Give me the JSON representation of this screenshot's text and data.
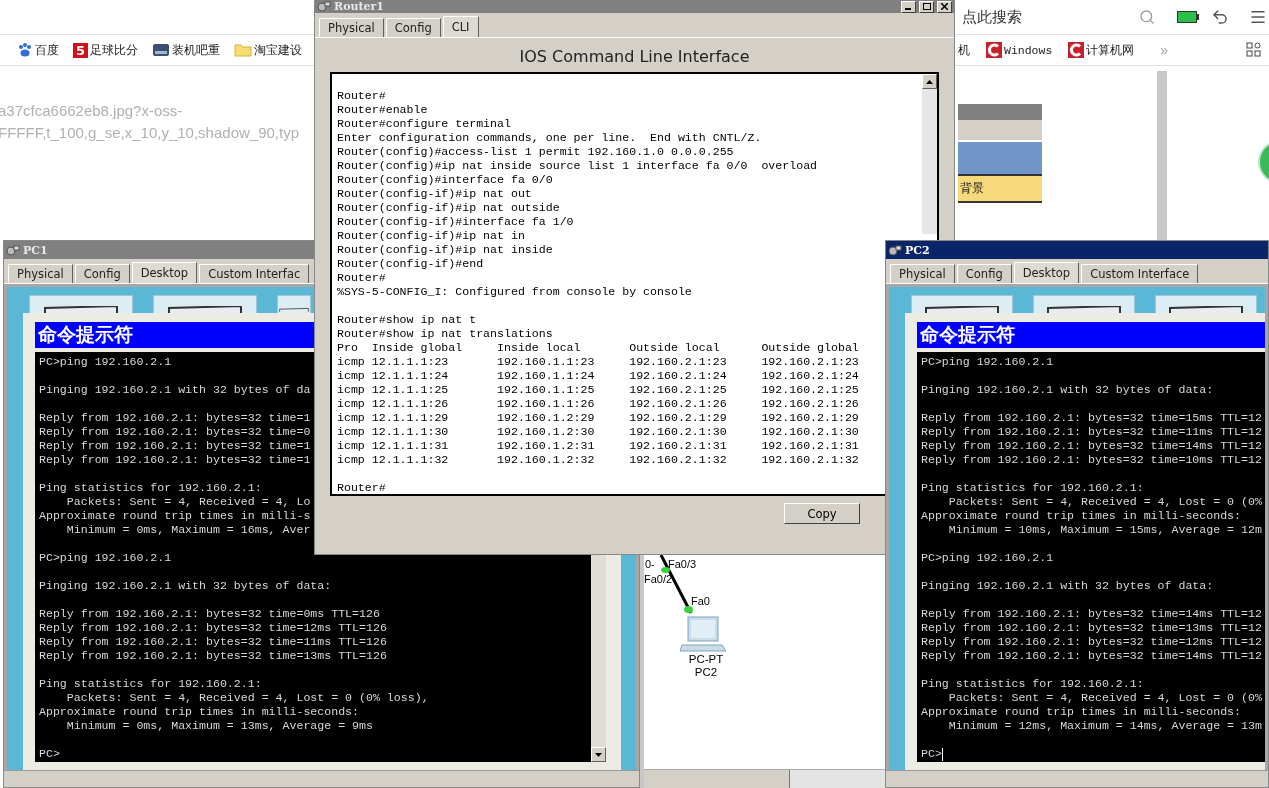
{
  "browser": {
    "search": {
      "placeholder": "点此搜索"
    },
    "bookmarks": [
      {
        "kind": "paw",
        "label": "百度"
      },
      {
        "kind": "number",
        "mark": "5",
        "label": "足球比分"
      },
      {
        "kind": "drive",
        "label": "装机吧重"
      },
      {
        "kind": "folder",
        "label": "淘宝建设"
      }
    ],
    "bookmarks_right": [
      {
        "kind": "plain",
        "label": "机"
      },
      {
        "kind": "c",
        "label": "Windows"
      },
      {
        "kind": "c",
        "label": "计算机网"
      }
    ],
    "more": "»",
    "url_lines": [
      "a37cfca6662eb8.jpg?x-oss-",
      "FFFFF,t_100,g_se,x_10,y_10,shadow_90,typ"
    ],
    "panel_label": "背景"
  },
  "workspace": {
    "ports": [
      {
        "label": "0-"
      },
      {
        "label": "Fa0/3"
      },
      {
        "label": "Fa0/2"
      },
      {
        "label": "Fa0"
      }
    ],
    "device": {
      "model": "PC-PT",
      "name": "PC2"
    }
  },
  "pc1": {
    "title": "PC1",
    "active": false,
    "tabs": [
      {
        "label": "Physical",
        "selected": false
      },
      {
        "label": "Config",
        "selected": false
      },
      {
        "label": "Desktop",
        "selected": true
      },
      {
        "label": "Custom Interfac",
        "selected": false
      }
    ],
    "prompt_title": "命令提示符",
    "cursor": false,
    "blocks": [
      [
        "PC>ping 192.160.2.1"
      ],
      [
        "Pinging 192.160.2.1 with 32 bytes of da"
      ],
      [
        "Reply from 192.160.2.1: bytes=32 time=1",
        "Reply from 192.160.2.1: bytes=32 time=0",
        "Reply from 192.160.2.1: bytes=32 time=1",
        "Reply from 192.160.2.1: bytes=32 time=1"
      ],
      [
        "Ping statistics for 192.160.2.1:",
        "    Packets: Sent = 4, Received = 4, Lo",
        "Approximate round trip times in milli-s",
        "    Minimum = 0ms, Maximum = 16ms, Aver"
      ],
      [
        "PC>ping 192.160.2.1"
      ],
      [
        "Pinging 192.160.2.1 with 32 bytes of data:"
      ],
      [
        "Reply from 192.160.2.1: bytes=32 time=0ms TTL=126",
        "Reply from 192.160.2.1: bytes=32 time=12ms TTL=126",
        "Reply from 192.160.2.1: bytes=32 time=11ms TTL=126",
        "Reply from 192.160.2.1: bytes=32 time=13ms TTL=126"
      ],
      [
        "Ping statistics for 192.160.2.1:",
        "    Packets: Sent = 4, Received = 4, Lost = 0 (0% loss),",
        "Approximate round trip times in milli-seconds:",
        "    Minimum = 0ms, Maximum = 13ms, Average = 9ms"
      ],
      [
        "PC>"
      ]
    ]
  },
  "router": {
    "title": "Router1",
    "active": false,
    "tabs": [
      {
        "label": "Physical",
        "selected": false
      },
      {
        "label": "Config",
        "selected": false
      },
      {
        "label": "CLI",
        "selected": true
      }
    ],
    "heading": "IOS Command Line Interface",
    "blocks": [
      [
        "Router#",
        "Router#enable",
        "Router#configure terminal",
        "Enter configuration commands, one per line.  End with CNTL/Z.",
        "Router(config)#access-list 1 permit 192.160.1.0 0.0.0.255",
        "Router(config)#ip nat inside source list 1 interface fa 0/0  overload",
        "Router(config)#interface fa 0/0",
        "Router(config-if)#ip nat out",
        "Router(config-if)#ip nat outside",
        "Router(config-if)#interface fa 1/0",
        "Router(config-if)#ip nat in",
        "Router(config-if)#ip nat inside",
        "Router(config-if)#end",
        "Router#",
        "%SYS-5-CONFIG_I: Configured from console by console"
      ],
      [
        "Router#show ip nat t",
        "Router#show ip nat translations",
        "Pro  Inside global     Inside local       Outside local      Outside global",
        "icmp 12.1.1.1:23       192.160.1.1:23     192.160.2.1:23     192.160.2.1:23",
        "icmp 12.1.1.1:24       192.160.1.1:24     192.160.2.1:24     192.160.2.1:24",
        "icmp 12.1.1.1:25       192.160.1.1:25     192.160.2.1:25     192.160.2.1:25",
        "icmp 12.1.1.1:26       192.160.1.1:26     192.160.2.1:26     192.160.2.1:26",
        "icmp 12.1.1.1:29       192.160.1.2:29     192.160.2.1:29     192.160.2.1:29",
        "icmp 12.1.1.1:30       192.160.1.2:30     192.160.2.1:30     192.160.2.1:30",
        "icmp 12.1.1.1:31       192.160.1.2:31     192.160.2.1:31     192.160.2.1:31",
        "icmp 12.1.1.1:32       192.160.1.2:32     192.160.2.1:32     192.160.2.1:32"
      ],
      [
        "Router#"
      ]
    ],
    "buttons": [
      "Copy"
    ]
  },
  "pc2": {
    "title": "PC2",
    "active": true,
    "tabs": [
      {
        "label": "Physical",
        "selected": false
      },
      {
        "label": "Config",
        "selected": false
      },
      {
        "label": "Desktop",
        "selected": true
      },
      {
        "label": "Custom Interface",
        "selected": false
      }
    ],
    "prompt_title": "命令提示符",
    "cursor": true,
    "blocks": [
      [
        "PC>ping 192.160.2.1"
      ],
      [
        "Pinging 192.160.2.1 with 32 bytes of data:"
      ],
      [
        "Reply from 192.160.2.1: bytes=32 time=15ms TTL=12",
        "Reply from 192.160.2.1: bytes=32 time=11ms TTL=12",
        "Reply from 192.160.2.1: bytes=32 time=14ms TTL=12",
        "Reply from 192.160.2.1: bytes=32 time=10ms TTL=12"
      ],
      [
        "Ping statistics for 192.160.2.1:",
        "    Packets: Sent = 4, Received = 4, Lost = 0 (0%",
        "Approximate round trip times in milli-seconds:",
        "    Minimum = 10ms, Maximum = 15ms, Average = 12m"
      ],
      [
        "PC>ping 192.160.2.1"
      ],
      [
        "Pinging 192.160.2.1 with 32 bytes of data:"
      ],
      [
        "Reply from 192.160.2.1: bytes=32 time=14ms TTL=12",
        "Reply from 192.160.2.1: bytes=32 time=13ms TTL=12",
        "Reply from 192.160.2.1: bytes=32 time=12ms TTL=12",
        "Reply from 192.160.2.1: bytes=32 time=14ms TTL=12"
      ],
      [
        "Ping statistics for 192.160.2.1:",
        "    Packets: Sent = 4, Received = 4, Lost = 0 (0%",
        "Approximate round trip times in milli-seconds:",
        "    Minimum = 12ms, Maximum = 14ms, Average = 13m"
      ],
      [
        "PC>"
      ]
    ]
  }
}
